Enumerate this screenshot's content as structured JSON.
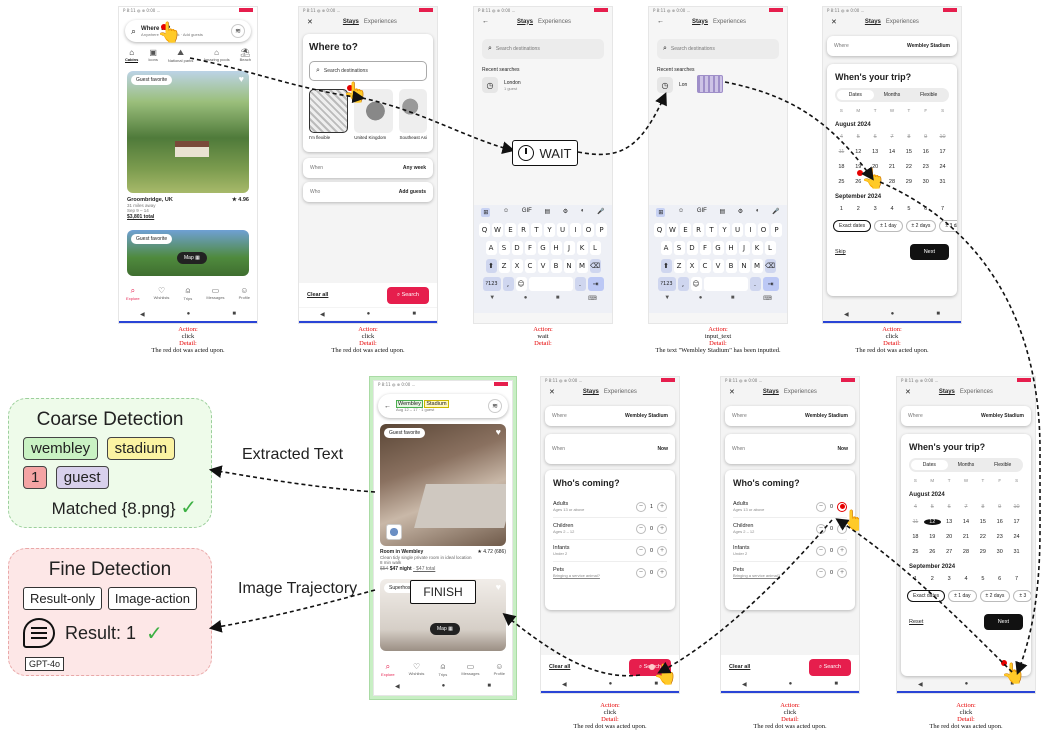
{
  "status_text": "P 8:11 ◍ ⊕ 0:00   ...",
  "phone1": {
    "search_title": "Where to?",
    "search_sub": "Anywhere · Any week · Add guests",
    "categories": [
      "Cabins",
      "Icons",
      "National parks",
      "Amazing pools",
      "Beach"
    ],
    "badge": "Guest favorite",
    "listing_title": "Groombridge, UK",
    "rating": "★ 4.96",
    "distance": "31 miles away",
    "dates": "Sep 9 – 14",
    "price": "$3,801 total",
    "badge2": "Guest favorite",
    "map_label": "Map",
    "tabs": [
      "Explore",
      "Wishlists",
      "Trips",
      "Messages",
      "Profile"
    ]
  },
  "phone2": {
    "tab_stays": "Stays",
    "tab_experiences": "Experiences",
    "where_to": "Where to?",
    "search_placeholder": "Search destinations",
    "region1": "I'm flexible",
    "region2": "United Kingdom",
    "region3": "Southeast Asi",
    "when_label": "When",
    "when_value": "Any week",
    "who_label": "Who",
    "who_value": "Add guests",
    "clear_all": "Clear all",
    "search_btn": "Search"
  },
  "phone3": {
    "tab_stays": "Stays",
    "tab_experiences": "Experiences",
    "search_placeholder": "Search destinations",
    "recent_label": "Recent searches",
    "recent_place": "London",
    "recent_guests": "1 guest"
  },
  "phone4": {
    "tab_stays": "Stays",
    "tab_experiences": "Experiences",
    "search_placeholder": "Search destinations",
    "recent_label": "Recent searches",
    "recent_place": "Lon"
  },
  "keyboard": {
    "top": [
      "⊞",
      "☺",
      "GIF",
      "▤",
      "⚙",
      "◐",
      "🎤"
    ],
    "row1": [
      "Q",
      "W",
      "E",
      "R",
      "T",
      "Y",
      "U",
      "I",
      "O",
      "P"
    ],
    "row2": [
      "A",
      "S",
      "D",
      "F",
      "G",
      "H",
      "J",
      "K",
      "L"
    ],
    "row3": [
      "⬆",
      "Z",
      "X",
      "C",
      "V",
      "B",
      "N",
      "M",
      "⌫"
    ],
    "row4_left": "?123",
    "comma": ",",
    "emoji": "☺",
    "dot": ".",
    "enter": "⇥"
  },
  "phone5": {
    "tab_stays": "Stays",
    "tab_experiences": "Experiences",
    "where_label": "Where",
    "where_value": "Wembley Stadium",
    "question": "When's your trip?",
    "seg": [
      "Dates",
      "Months",
      "Flexible"
    ],
    "weekdays": [
      "S",
      "M",
      "T",
      "W",
      "T",
      "F",
      "S"
    ],
    "month1": "August 2024",
    "aug_rows": [
      [
        "",
        "",
        "",
        "",
        "1",
        "2",
        "3"
      ],
      [
        "4",
        "5",
        "6",
        "7",
        "8",
        "9",
        "10"
      ],
      [
        "11",
        "12",
        "13",
        "14",
        "15",
        "16",
        "17"
      ],
      [
        "18",
        "19",
        "20",
        "21",
        "22",
        "23",
        "24"
      ],
      [
        "25",
        "26",
        "27",
        "28",
        "29",
        "30",
        "31"
      ]
    ],
    "month2": "September 2024",
    "sep_row": [
      "1",
      "2",
      "3",
      "4",
      "5",
      "6",
      "7"
    ],
    "chips": [
      "Exact dates",
      "± 1 day",
      "± 2 days",
      "± 3 da"
    ],
    "skip": "Skip",
    "next": "Next"
  },
  "phone6": {
    "tab_stays": "Stays",
    "tab_experiences": "Experiences",
    "where_label": "Where",
    "where_value": "Wembley Stadium",
    "question": "When's your trip?",
    "seg": [
      "Dates",
      "Months",
      "Flexible"
    ],
    "month1": "August 2024",
    "month2": "September 2024",
    "chips": [
      "Exact dates",
      "± 1 day",
      "± 2 days",
      "± 3"
    ],
    "reset": "Reset",
    "next": "Next"
  },
  "phone7": {
    "tab_stays": "Stays",
    "tab_experiences": "Experiences",
    "where_label": "Where",
    "where_value": "Wembley Stadium",
    "when_label": "When",
    "when_value": "Now",
    "question": "Who's coming?",
    "guests": [
      {
        "label": "Adults",
        "sub": "Ages 13 or above",
        "count": "1"
      },
      {
        "label": "Children",
        "sub": "Ages 2 – 12",
        "count": "0"
      },
      {
        "label": "Infants",
        "sub": "Under 2",
        "count": "0"
      },
      {
        "label": "Pets",
        "sub": "Bringing a service animal?",
        "count": "0"
      }
    ],
    "clear_all": "Clear all",
    "search_btn": "Search"
  },
  "phone8": {
    "tab_stays": "Stays",
    "tab_experiences": "Experiences",
    "where_label": "Where",
    "where_value": "Wembley Stadium",
    "when_label": "When",
    "when_value": "Now",
    "question": "Who's coming?",
    "guests": [
      {
        "label": "Adults",
        "sub": "Ages 13 or above",
        "count": "0"
      },
      {
        "label": "Children",
        "sub": "Ages 2 – 12",
        "count": "0"
      },
      {
        "label": "Infants",
        "sub": "Under 2",
        "count": "0"
      },
      {
        "label": "Pets",
        "sub": "Bringing a service animal?",
        "count": "0"
      }
    ],
    "clear_all": "Clear all",
    "search_btn": "Search"
  },
  "phone9": {
    "search_word1": "Wembley",
    "search_word2": "Stadium",
    "search_sub": "Aug 12 – 17 · 1 guest",
    "badge": "Guest favorite",
    "room_title": "Room in Wembley",
    "rating": "★ 4.72 (686)",
    "desc": "Clean tidy single private room in ideal location",
    "walk": "8 min walk",
    "price_old": "$54",
    "price": "$47 night",
    "price_total": "· $47 total",
    "badge2": "Superhost",
    "map_label": "Map",
    "tabs": [
      "Explore",
      "Wishlists",
      "Trips",
      "Messages",
      "Profile"
    ]
  },
  "captions": {
    "c1": {
      "action": "Action:",
      "value": "click",
      "detail": "Detail:",
      "text": "The red dot was acted upon."
    },
    "c2": {
      "action": "Action:",
      "value": "click",
      "detail": "Detail:",
      "text": "The red dot was acted upon."
    },
    "c3": {
      "action": "Action:",
      "value": "wait",
      "detail": "Detail:",
      "text": ""
    },
    "c4": {
      "action": "Action:",
      "value": "input_text",
      "detail": "Detail:",
      "text": "The text \"Wembley Stadium\" has been inputted."
    },
    "c5": {
      "action": "Action:",
      "value": "click",
      "detail": "Detail:",
      "text": "The red dot was acted upon."
    },
    "c6": {
      "action": "Action:",
      "value": "click",
      "detail": "Detail:",
      "text": "The red dot was acted upon."
    },
    "c7": {
      "action": "Action:",
      "value": "click",
      "detail": "Detail:",
      "text": "The red dot was acted upon."
    },
    "c8": {
      "action": "Action:",
      "value": "click",
      "detail": "Detail:",
      "text": "The red dot was acted upon."
    }
  },
  "wait_label": "WAIT",
  "finish_label": "FINISH",
  "coarse": {
    "title": "Coarse Detection",
    "tags": [
      "wembley",
      "stadium",
      "1",
      "guest"
    ],
    "matched": "Matched {8.png}",
    "check": "✓",
    "arrow_label": "Extracted Text"
  },
  "fine": {
    "title": "Fine Detection",
    "opt1": "Result-only",
    "opt2": "Image-action",
    "result": "Result: 1",
    "check": "✓",
    "model": "GPT-4o",
    "arrow_label": "Image Trajectory"
  },
  "colors": {
    "accent_red": "#e61e4d",
    "nav_blue": "#2a44d6",
    "tag_green": "#c9f2c3",
    "tag_yellow": "#fbf3a2",
    "tag_red": "#f4a4a4",
    "tag_purple": "#d8d0ec",
    "coarse_bg": "#eefbea",
    "fine_bg": "#fde7e7"
  }
}
